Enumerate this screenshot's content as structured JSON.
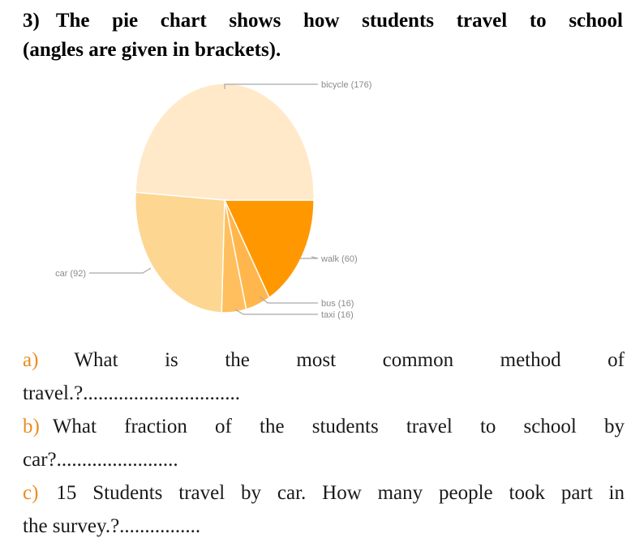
{
  "heading": {
    "number": "3)",
    "line1": "The pie chart shows how students travel to school",
    "line2": "(angles are given in brackets)."
  },
  "chart_data": {
    "type": "pie",
    "title": "",
    "unit": "degrees",
    "note": "angles are given in brackets",
    "categories": [
      "walk",
      "bus",
      "taxi",
      "car",
      "bicycle"
    ],
    "values": [
      60,
      16,
      16,
      92,
      176
    ],
    "labels": [
      "walk (60)",
      "bus (16)",
      "taxi (16)",
      "car (92)",
      "bicycle (176)"
    ],
    "colors": [
      "#FF9800",
      "#FFB74D",
      "#FFBF5E",
      "#FDD692",
      "#FFE9C8"
    ],
    "legend": "none",
    "label_style": "leader-lines",
    "total": 360
  },
  "questions": [
    {
      "marker": "a)",
      "line1": "What is the most common method of",
      "line2": "travel.?..............................."
    },
    {
      "marker": "b)",
      "line1": "What fraction of the students travel to school by",
      "line2": "car?........................"
    },
    {
      "marker": "c)",
      "line1": "15 Students travel by car. How many people took part in",
      "line2": "the survey.?................"
    }
  ]
}
